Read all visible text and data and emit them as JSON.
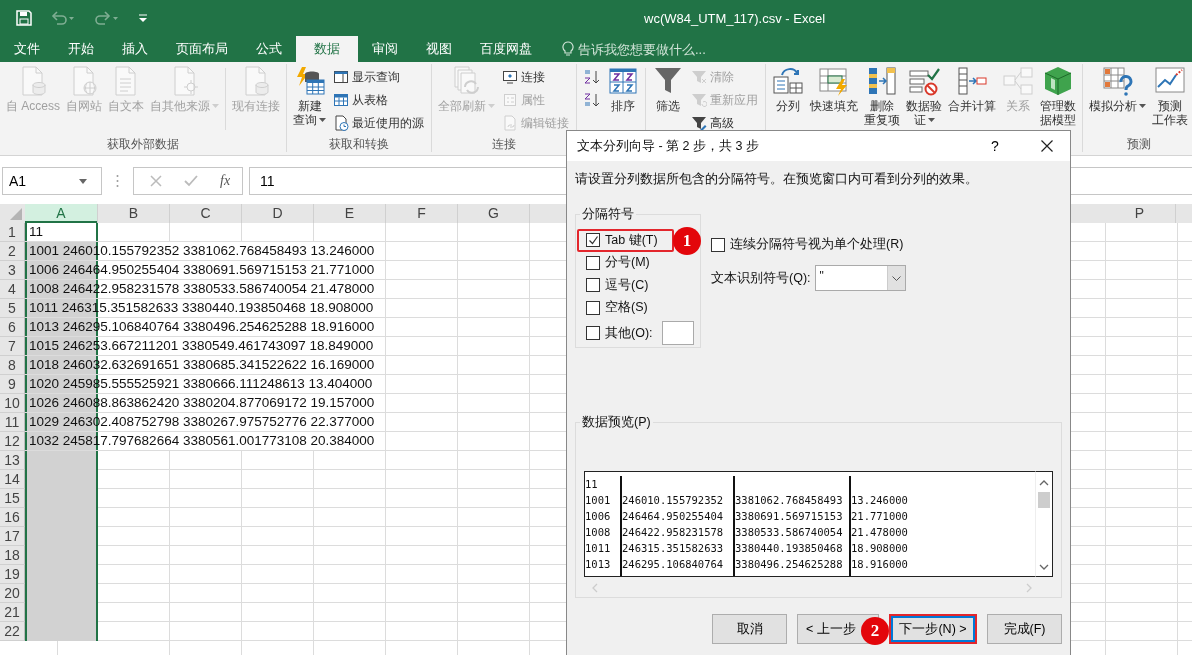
{
  "title_bar": {
    "title": "wc(W84_UTM_117).csv - Excel"
  },
  "tabs": [
    {
      "label": "文件",
      "selected": false
    },
    {
      "label": "开始",
      "selected": false
    },
    {
      "label": "插入",
      "selected": false
    },
    {
      "label": "页面布局",
      "selected": false
    },
    {
      "label": "公式",
      "selected": false
    },
    {
      "label": "数据",
      "selected": true
    },
    {
      "label": "审阅",
      "selected": false
    },
    {
      "label": "视图",
      "selected": false
    },
    {
      "label": "百度网盘",
      "selected": false
    }
  ],
  "tell_me": {
    "placeholder": "告诉我您想要做什么..."
  },
  "ribbon": {
    "groups": [
      {
        "label": "获取外部数据",
        "items": [
          {
            "kind": "large",
            "lines": [
              "自 Access"
            ],
            "disabled": true,
            "menu": false
          },
          {
            "kind": "large",
            "lines": [
              "自网站"
            ],
            "disabled": true,
            "menu": false
          },
          {
            "kind": "large",
            "lines": [
              "自文本"
            ],
            "disabled": true,
            "menu": false
          },
          {
            "kind": "large",
            "lines": [
              "自其他来源"
            ],
            "disabled": true,
            "menu": true
          },
          {
            "kind": "separator"
          },
          {
            "kind": "large",
            "lines": [
              "现有连接"
            ],
            "disabled": true,
            "menu": false
          }
        ]
      },
      {
        "label": "获取和转换",
        "items": [
          {
            "kind": "large",
            "lines": [
              "新建",
              "查询"
            ],
            "disabled": false,
            "menu": true
          },
          {
            "kind": "stack",
            "items": [
              {
                "label": "显示查询",
                "disabled": false
              },
              {
                "label": "从表格",
                "disabled": false
              },
              {
                "label": "最近使用的源",
                "disabled": false
              }
            ]
          }
        ]
      },
      {
        "label": "连接",
        "items": [
          {
            "kind": "large",
            "lines": [
              "全部刷新"
            ],
            "disabled": true,
            "menu": true
          },
          {
            "kind": "stack",
            "items": [
              {
                "label": "连接",
                "disabled": false
              },
              {
                "label": "属性",
                "disabled": true
              },
              {
                "label": "编辑链接",
                "disabled": true
              }
            ]
          }
        ]
      },
      {
        "items": [
          {
            "kind": "stack",
            "items": [
              {
                "disabled": false
              },
              {
                "disabled": false
              }
            ]
          },
          {
            "kind": "large",
            "lines": [
              "排序"
            ],
            "disabled": false,
            "menu": false
          },
          {
            "kind": "separator"
          },
          {
            "kind": "large",
            "lines": [
              "筛选"
            ],
            "disabled": false,
            "menu": false
          },
          {
            "kind": "stack",
            "items": [
              {
                "label": "清除",
                "disabled": true
              },
              {
                "label": "重新应用",
                "disabled": true
              },
              {
                "label": "高级",
                "disabled": false
              }
            ]
          }
        ]
      },
      {
        "items": [
          {
            "kind": "large",
            "lines": [
              "分列"
            ],
            "disabled": false,
            "menu": false
          },
          {
            "kind": "large",
            "lines": [
              "快速填充"
            ],
            "disabled": false,
            "menu": false
          },
          {
            "kind": "large",
            "lines": [
              "删除",
              "重复项"
            ],
            "disabled": false,
            "menu": false
          },
          {
            "kind": "large",
            "lines": [
              "数据验",
              "证"
            ],
            "disabled": false,
            "menu": true
          },
          {
            "kind": "large",
            "lines": [
              "合并计算"
            ],
            "disabled": false,
            "menu": false
          },
          {
            "kind": "large",
            "lines": [
              "关系"
            ],
            "disabled": true,
            "menu": false
          },
          {
            "kind": "large",
            "lines": [
              "管理数",
              "据模型"
            ],
            "disabled": false,
            "menu": false
          }
        ]
      },
      {
        "label": "预测",
        "items": [
          {
            "kind": "large",
            "lines": [
              "模拟分析"
            ],
            "disabled": false,
            "menu": true
          },
          {
            "kind": "large",
            "lines": [
              "预测",
              "工作表"
            ],
            "disabled": false,
            "menu": false
          }
        ]
      }
    ]
  },
  "formula_bar": {
    "name_box": "A1",
    "function_label": "fx",
    "value": "11"
  },
  "sheet": {
    "columns": [
      {
        "label": "A",
        "selected": true
      },
      {
        "label": "B",
        "selected": false
      },
      {
        "label": "C",
        "selected": false
      },
      {
        "label": "D",
        "selected": false
      },
      {
        "label": "E",
        "selected": false
      },
      {
        "label": "F",
        "selected": false
      },
      {
        "label": "G",
        "selected": false
      },
      {
        "label": "P",
        "selected": false
      }
    ],
    "rows": [
      {
        "label": "1",
        "active": true,
        "cell_a": "11"
      },
      {
        "label": "2",
        "active": false,
        "cell_a": "1001 246010.155792352 3381062.768458493 13.246000"
      },
      {
        "label": "3",
        "active": false,
        "cell_a": "1006 246464.950255404 3380691.569715153 21.771000"
      },
      {
        "label": "4",
        "active": false,
        "cell_a": "1008 246422.958231578 3380533.586740054 21.478000"
      },
      {
        "label": "5",
        "active": false,
        "cell_a": "1011 246315.351582633 3380440.193850468 18.908000"
      },
      {
        "label": "6",
        "active": false,
        "cell_a": "1013 246295.106840764 3380496.254625288 18.916000"
      },
      {
        "label": "7",
        "active": false,
        "cell_a": "1015 246253.667211201 3380549.461743097 18.849000"
      },
      {
        "label": "8",
        "active": false,
        "cell_a": "1018 246032.632691651 3380685.341522622 16.169000"
      },
      {
        "label": "9",
        "active": false,
        "cell_a": "1020 245985.555525921 3380666.111248613 13.404000"
      },
      {
        "label": "10",
        "active": false,
        "cell_a": "1026 246088.863862420 3380204.877069172 19.157000"
      },
      {
        "label": "11",
        "active": false,
        "cell_a": "1029 246302.408752798 3380267.975752776 22.377000"
      },
      {
        "label": "12",
        "active": false,
        "cell_a": "1032 245817.797682664 3380561.001773108 20.384000"
      },
      {
        "label": "13",
        "active": false
      },
      {
        "label": "14",
        "active": false
      },
      {
        "label": "15",
        "active": false
      },
      {
        "label": "16",
        "active": false
      },
      {
        "label": "17",
        "active": false
      },
      {
        "label": "18",
        "active": false
      },
      {
        "label": "19",
        "active": false
      },
      {
        "label": "20",
        "active": false
      },
      {
        "label": "21",
        "active": false
      },
      {
        "label": "22",
        "active": false
      }
    ]
  },
  "dialog": {
    "title": "文本分列向导 - 第 2 步，共 3 步",
    "help": "?",
    "instruction": "请设置分列数据所包含的分隔符号。在预览窗口内可看到分列的效果。",
    "delimiters": {
      "label": "分隔符号",
      "options": [
        {
          "kind": "checkbox",
          "label": "Tab 键(T)",
          "checked": true,
          "highlighted": true
        },
        {
          "kind": "checkbox",
          "label": "分号(M)",
          "checked": false,
          "highlighted": false
        },
        {
          "kind": "checkbox",
          "label": "逗号(C)",
          "checked": false,
          "highlighted": false
        },
        {
          "kind": "checkbox",
          "label": "空格(S)",
          "checked": false,
          "highlighted": false
        },
        {
          "kind": "checkbox_with_field",
          "label": "其他(O):",
          "checked": false,
          "highlighted": false
        }
      ]
    },
    "consecutive": {
      "label": "连续分隔符号视为单个处理(R)",
      "checked": false
    },
    "qualifier": {
      "label": "文本识别符号(Q):",
      "value": "\""
    },
    "preview": {
      "label": "数据预览(P)",
      "rows": [
        [
          "11"
        ],
        [
          "1001",
          "246010.155792352",
          "3381062.768458493",
          "13.246000"
        ],
        [
          "1006",
          "246464.950255404",
          "3380691.569715153",
          "21.771000"
        ],
        [
          "1008",
          "246422.958231578",
          "3380533.586740054",
          "21.478000"
        ],
        [
          "1011",
          "246315.351582633",
          "3380440.193850468",
          "18.908000"
        ],
        [
          "1013",
          "246295.106840764",
          "3380496.254625288",
          "18.916000"
        ]
      ]
    },
    "buttons": [
      {
        "label": "取消",
        "highlighted": false
      },
      {
        "label": "< 上一步",
        "highlighted": false
      },
      {
        "label": "下一步(N) >",
        "highlighted": true
      },
      {
        "label": "完成(F)",
        "highlighted": false
      }
    ],
    "callouts": [
      {
        "label": "1"
      },
      {
        "label": "2"
      }
    ]
  }
}
